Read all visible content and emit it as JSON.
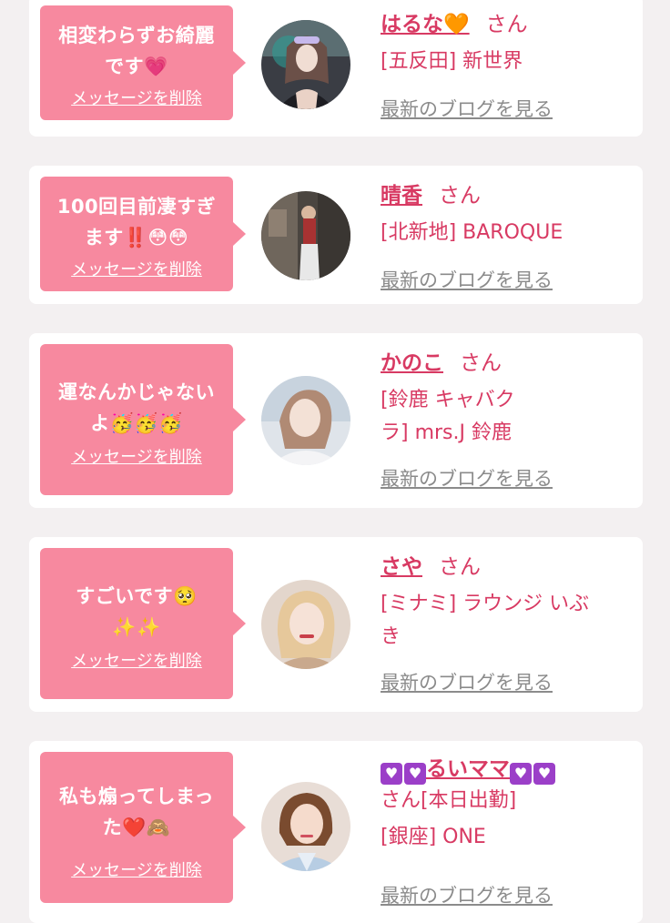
{
  "delete_label": "メッセージを削除",
  "blog_label": "最新のブログを見る",
  "san_label": "さん",
  "cards": [
    {
      "message_line1": "相変わらずお綺麗",
      "message_line2": "です💗",
      "name": "はるな🧡",
      "shop": "[五反田] 新世界"
    },
    {
      "message_line1": "100回目前凄すぎ",
      "message_line2": "ます‼️😳😳",
      "name": "晴香",
      "shop": "[北新地] BAROQUE"
    },
    {
      "message_line1": "運なんかじゃない",
      "message_line2": "よ🥳🥳🥳",
      "name": "かのこ",
      "shop_line1": "[鈴鹿 キャバク",
      "shop_line2": "ラ] mrs.J 鈴鹿"
    },
    {
      "message_line1": "すごいです🥺",
      "message_line2": "✨✨",
      "name": "さや",
      "shop_line1": "[ミナミ] ラウンジ いぶ",
      "shop_line2": "き"
    },
    {
      "message_line1": "私も煽ってしまっ",
      "message_line2": "た❤️🙈",
      "name": "るいママ",
      "name_line2": "さん[本日出勤]",
      "shop": "[銀座] ONE"
    }
  ],
  "icons": [
    "heart-emoji",
    "orange-heart-emoji",
    "flushed-face-emoji",
    "partying-face-emoji",
    "pleading-face-emoji",
    "sparkles-emoji",
    "see-no-evil-monkey-emoji",
    "purple-heart-icon"
  ],
  "colors": {
    "bubble": "#f7899f",
    "accent": "#d83a63",
    "link_gray": "#8b8b8b",
    "background": "#f3f0f1"
  }
}
